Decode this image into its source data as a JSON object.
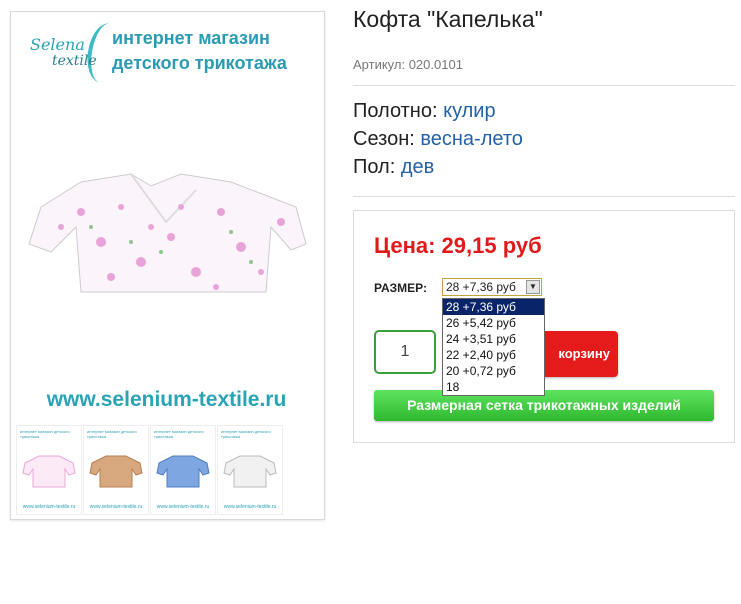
{
  "gallery": {
    "logo_line1": "Selena",
    "logo_line2": "textile",
    "shop_line1": "интернет магазин",
    "shop_line2": "детского трикотажа",
    "site_url": "www.selenium-textile.ru",
    "thumbnails": [
      {
        "head": "интернет магазин детского трикотажа",
        "url": "www.selenium-textile.ru",
        "color": "#e9a7d8"
      },
      {
        "head": "интернет магазин детского трикотажа",
        "url": "www.selenium-textile.ru",
        "color": "#c9905f"
      },
      {
        "head": "интернет магазин детского трикотажа",
        "url": "www.selenium-textile.ru",
        "color": "#5f8fd8"
      },
      {
        "head": "интернет магазин детского трикотажа",
        "url": "www.selenium-textile.ru",
        "color": "#c9c9c9"
      }
    ]
  },
  "product": {
    "title": "Кофта \"Капелька\"",
    "sku_label": "Артикул:",
    "sku_value": "020.0101",
    "attributes": [
      {
        "label": "Полотно:",
        "value": "кулир"
      },
      {
        "label": "Сезон:",
        "value": "весна-лето"
      },
      {
        "label": "Пол:",
        "value": "дев"
      }
    ]
  },
  "buybox": {
    "price": "Цена: 29,15 руб",
    "size_label": "РАЗМЕР:",
    "selected_size": "28 +7,36 руб",
    "size_options": [
      "28 +7,36 руб",
      "26 +5,42 руб",
      "24 +3,51 руб",
      "22 +2,40 руб",
      "20 +0,72 руб",
      "18"
    ],
    "quantity": "1",
    "cart_button": "корзину",
    "size_chart_button": "Размерная сетка трикотажных изделий"
  },
  "colors": {
    "price": "#e01a1a",
    "attribute_value": "#2461a6",
    "cart_button": "#e51b1b",
    "size_chart_button": "#3cc93c",
    "brand": "#2aa3b4"
  }
}
